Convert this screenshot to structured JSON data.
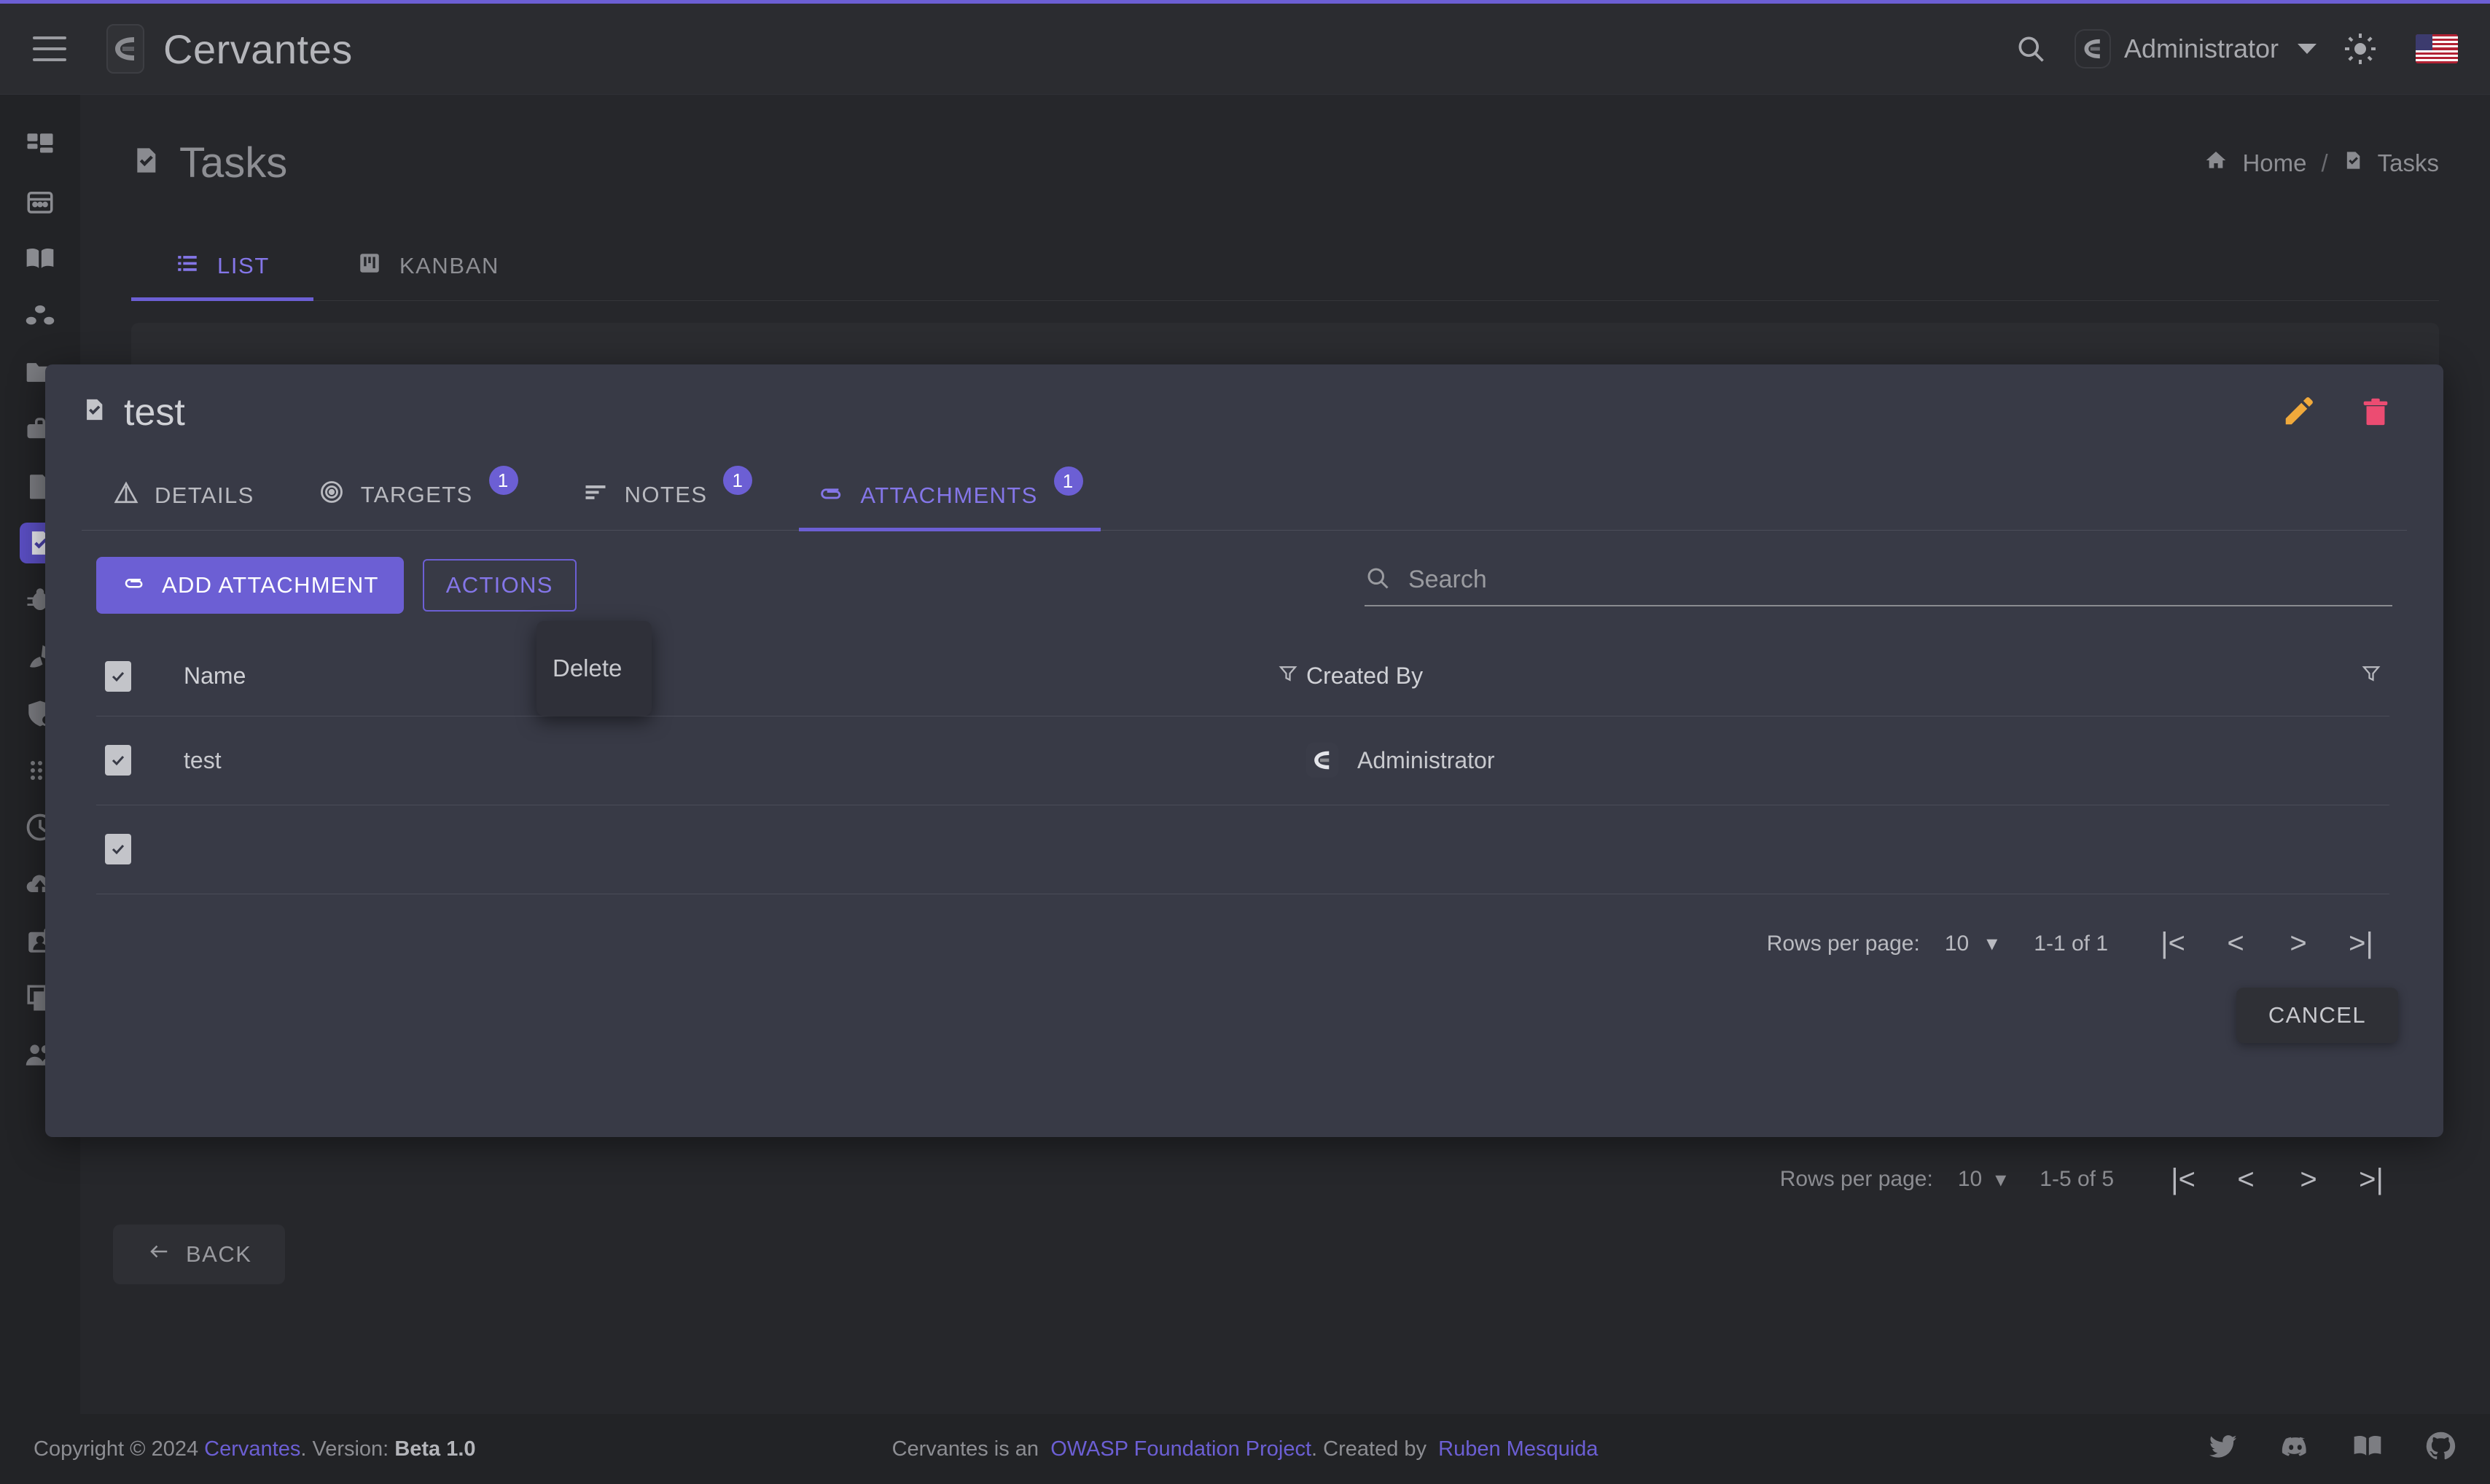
{
  "colors": {
    "accent": "#6c5fd4",
    "accent_text": "#8476e8",
    "page_bg": "#26272b",
    "modal_bg": "#383a46",
    "edit_icon": "#f0a93b",
    "delete_icon": "#ec4c72"
  },
  "header": {
    "brand": "Cervantes",
    "menu_icon": "hamburger-icon",
    "search_icon": "search-icon",
    "username": "Administrator",
    "theme_icon": "sun-icon",
    "language_icon": "us-flag-icon"
  },
  "sidebar": {
    "items": [
      {
        "icon": "dashboard-icon",
        "name": "dashboard"
      },
      {
        "icon": "calendar-icon",
        "name": "calendar"
      },
      {
        "icon": "book-icon",
        "name": "knowledge-base"
      },
      {
        "icon": "group-icon",
        "name": "organizations"
      },
      {
        "icon": "folder-icon",
        "name": "projects"
      },
      {
        "icon": "briefcase-icon",
        "name": "clients"
      },
      {
        "icon": "document-icon",
        "name": "reports"
      },
      {
        "icon": "task-icon",
        "name": "tasks",
        "active": true
      },
      {
        "icon": "bug-icon",
        "name": "vulnerabilities"
      },
      {
        "icon": "rocket-icon",
        "name": "exploits"
      },
      {
        "icon": "shield-icon",
        "name": "compliance"
      },
      {
        "icon": "grid-dots-icon",
        "name": "apps"
      },
      {
        "icon": "clock-icon",
        "name": "log"
      },
      {
        "icon": "cloud-upload-icon",
        "name": "uploads"
      },
      {
        "icon": "id-badge-icon",
        "name": "profile"
      },
      {
        "icon": "pages-icon",
        "name": "templates"
      },
      {
        "icon": "people-icon",
        "name": "users"
      }
    ]
  },
  "page": {
    "title": "Tasks",
    "title_icon": "task-icon",
    "breadcrumb": {
      "home": "Home",
      "separator": "/",
      "current": "Tasks",
      "home_icon": "home-icon",
      "current_icon": "task-icon"
    },
    "view_tabs": [
      {
        "label": "LIST",
        "icon": "list-icon",
        "active": true
      },
      {
        "label": "KANBAN",
        "icon": "kanban-icon",
        "active": false
      }
    ],
    "back_button": "BACK",
    "back_icon": "arrow-left-icon",
    "background_pagination": {
      "rows_label": "Rows per page:",
      "rows_value": "10",
      "range": "1-5 of 5",
      "first": "|<",
      "prev": "<",
      "next": ">",
      "last": ">|"
    }
  },
  "modal": {
    "title": "test",
    "title_icon": "task-icon",
    "edit_icon": "pencil-icon",
    "delete_icon": "trash-icon",
    "tabs": [
      {
        "label": "DETAILS",
        "icon": "warning-triangle-icon",
        "badge": "",
        "active": false
      },
      {
        "label": "TARGETS",
        "icon": "target-icon",
        "badge": "1",
        "active": false
      },
      {
        "label": "NOTES",
        "icon": "notes-icon",
        "badge": "1",
        "active": false
      },
      {
        "label": "ATTACHMENTS",
        "icon": "paperclip-icon",
        "badge": "1",
        "active": true
      }
    ],
    "toolbar": {
      "add_label": "ADD ATTACHMENT",
      "add_icon": "paperclip-icon",
      "actions_label": "ACTIONS"
    },
    "dropdown": {
      "open": true,
      "items": [
        "Delete"
      ]
    },
    "search": {
      "placeholder": "Search",
      "value": "",
      "icon": "search-icon"
    },
    "table": {
      "columns": [
        "Name",
        "Created By"
      ],
      "filter_icon": "filter-icon",
      "header_checkbox": "checked",
      "rows": [
        {
          "checked": true,
          "name": "test",
          "created_by": "Administrator",
          "avatar_icon": "cervantes-avatar-icon"
        },
        {
          "checked": true,
          "name": "",
          "created_by": "",
          "avatar_icon": ""
        }
      ]
    },
    "pagination": {
      "rows_label": "Rows per page:",
      "rows_value": "10",
      "range": "1-1 of 1",
      "first": "|<",
      "prev": "<",
      "next": ">",
      "last": ">|"
    },
    "cancel_label": "CANCEL"
  },
  "footer": {
    "copyright_prefix": "Copyright © 2024",
    "brand_link": "Cervantes",
    "version_label": ". Version:",
    "version_value": "Beta 1.0",
    "center_prefix": "Cervantes is an",
    "center_link1": "OWASP Foundation Project",
    "center_mid": ". Created by",
    "center_link2": "Ruben Mesquida",
    "icons": [
      "twitter-icon",
      "discord-icon",
      "book-icon",
      "github-icon"
    ]
  }
}
